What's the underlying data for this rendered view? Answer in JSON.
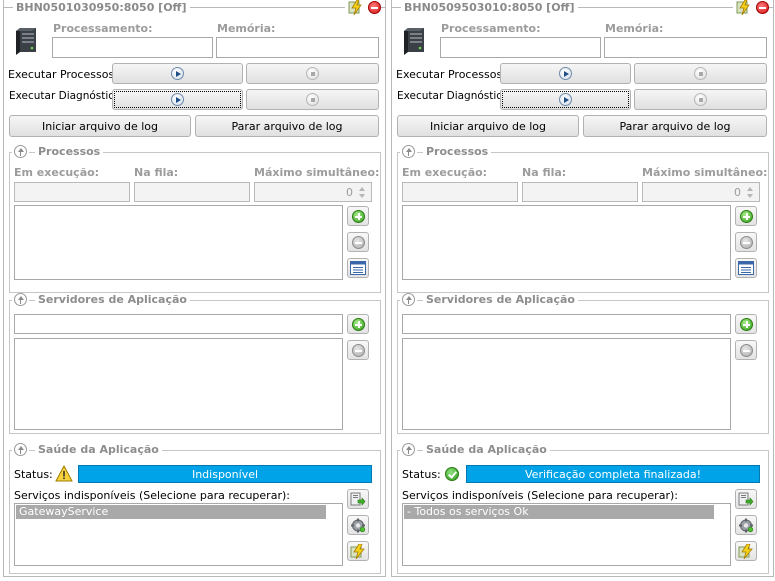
{
  "labels": {
    "processamento": "Processamento:",
    "memoria": "Memória:",
    "executar_processos": "Executar Processos:",
    "executar_diagnostico": "Executar Diagnóstico:",
    "iniciar_log": "Iniciar arquivo de log",
    "parar_log": "Parar arquivo de log",
    "processos": "Processos",
    "em_execucao": "Em execução:",
    "na_fila": "Na fila:",
    "maximo_simultaneo": "Máximo simultâneo:",
    "servidores": "Servidores de Aplicação",
    "saude": "Saúde da Aplicação",
    "status": "Status:",
    "servicos_indisponiveis": "Serviços indisponíveis (Selecione para recuperar):"
  },
  "panels": [
    {
      "title": "BHN0501030950:8050 [Off]",
      "max_simultaneo": "0",
      "status_icon": "warning-icon",
      "status_text": "Indisponível",
      "services": [
        "GatewayService"
      ]
    },
    {
      "title": "BHN0509503010:8050 [Off]",
      "max_simultaneo": "0",
      "status_icon": "ok-icon",
      "status_text": "Verificação completa finalizada!",
      "services": [
        "- Todos os serviços Ok"
      ]
    }
  ],
  "colors": {
    "status_bar": "#00a2e8",
    "selected_row": "#a9a9a9"
  }
}
